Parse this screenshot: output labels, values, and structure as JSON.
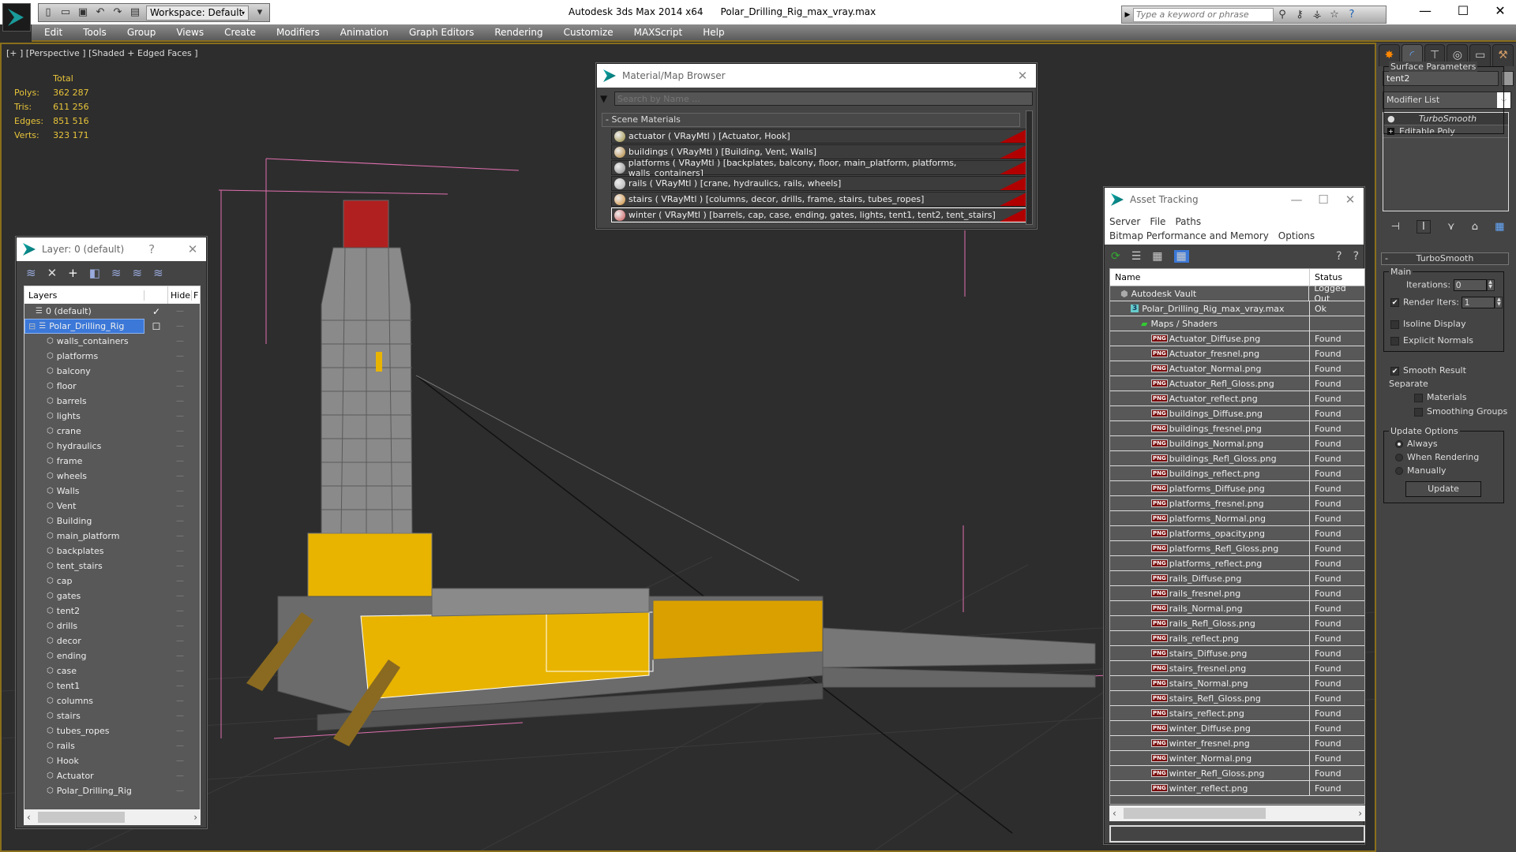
{
  "app": {
    "name": "Autodesk 3ds Max  2014 x64",
    "file": "Polar_Drilling_Rig_max_vray.max",
    "workspace": "Workspace: Default",
    "search_placeholder": "Type a keyword or phrase"
  },
  "menu": [
    "Edit",
    "Tools",
    "Group",
    "Views",
    "Create",
    "Modifiers",
    "Animation",
    "Graph Editors",
    "Rendering",
    "Customize",
    "MAXScript",
    "Help"
  ],
  "viewport": {
    "label": "[+ ] [Perspective ] [Shaded + Edged Faces ]",
    "stats_header": "Total",
    "stats": [
      {
        "label": "Polys:",
        "value": "362 287"
      },
      {
        "label": "Tris:",
        "value": "611 256"
      },
      {
        "label": "Edges:",
        "value": "851 516"
      },
      {
        "label": "Verts:",
        "value": "323 171"
      }
    ]
  },
  "layer_panel": {
    "title": "Layer: 0 (default)",
    "help": "?",
    "close": "✕",
    "col_layers": "Layers",
    "col_hide": "Hide",
    "col_freeze": "F",
    "rows": [
      {
        "name": "0 (default)",
        "level": 1,
        "type": "layer",
        "check": "✓"
      },
      {
        "name": "Polar_Drilling_Rig",
        "level": 0,
        "type": "layer",
        "selected": true,
        "check": "☐"
      },
      {
        "name": "walls_containers",
        "level": 2,
        "type": "object"
      },
      {
        "name": "platforms",
        "level": 2,
        "type": "object"
      },
      {
        "name": "balcony",
        "level": 2,
        "type": "object"
      },
      {
        "name": "floor",
        "level": 2,
        "type": "object"
      },
      {
        "name": "barrels",
        "level": 2,
        "type": "object"
      },
      {
        "name": "lights",
        "level": 2,
        "type": "object"
      },
      {
        "name": "crane",
        "level": 2,
        "type": "object"
      },
      {
        "name": "hydraulics",
        "level": 2,
        "type": "object"
      },
      {
        "name": "frame",
        "level": 2,
        "type": "object"
      },
      {
        "name": "wheels",
        "level": 2,
        "type": "object"
      },
      {
        "name": "Walls",
        "level": 2,
        "type": "object"
      },
      {
        "name": "Vent",
        "level": 2,
        "type": "object"
      },
      {
        "name": "Building",
        "level": 2,
        "type": "object"
      },
      {
        "name": "main_platform",
        "level": 2,
        "type": "object"
      },
      {
        "name": "backplates",
        "level": 2,
        "type": "object"
      },
      {
        "name": "tent_stairs",
        "level": 2,
        "type": "object"
      },
      {
        "name": "cap",
        "level": 2,
        "type": "object"
      },
      {
        "name": "gates",
        "level": 2,
        "type": "object"
      },
      {
        "name": "tent2",
        "level": 2,
        "type": "object"
      },
      {
        "name": "drills",
        "level": 2,
        "type": "object"
      },
      {
        "name": "decor",
        "level": 2,
        "type": "object"
      },
      {
        "name": "ending",
        "level": 2,
        "type": "object"
      },
      {
        "name": "case",
        "level": 2,
        "type": "object"
      },
      {
        "name": "tent1",
        "level": 2,
        "type": "object"
      },
      {
        "name": "columns",
        "level": 2,
        "type": "object"
      },
      {
        "name": "stairs",
        "level": 2,
        "type": "object"
      },
      {
        "name": "tubes_ropes",
        "level": 2,
        "type": "object"
      },
      {
        "name": "rails",
        "level": 2,
        "type": "object"
      },
      {
        "name": "Hook",
        "level": 2,
        "type": "object"
      },
      {
        "name": "Actuator",
        "level": 2,
        "type": "object"
      },
      {
        "name": "Polar_Drilling_Rig",
        "level": 2,
        "type": "object"
      }
    ]
  },
  "material_browser": {
    "title": "Material/Map Browser",
    "search_placeholder": "Search by Name ...",
    "section": "- Scene Materials",
    "materials": [
      {
        "label": "actuator  ( VRayMtl )  [Actuator, Hook]"
      },
      {
        "label": "buildings  ( VRayMtl )  [Building, Vent, Walls]"
      },
      {
        "label": "platforms  ( VRayMtl )  [backplates, balcony, floor, main_platform, platforms, walls_containers]"
      },
      {
        "label": "rails  ( VRayMtl )  [crane, hydraulics, rails, wheels]"
      },
      {
        "label": "stairs  ( VRayMtl )  [columns, decor, drills, frame, stairs, tubes_ropes]"
      },
      {
        "label": "winter  ( VRayMtl )  [barrels, cap, case, ending, gates, lights, tent1, tent2, tent_stairs]",
        "selected": true
      }
    ]
  },
  "asset_tracking": {
    "title": "Asset Tracking",
    "menu": [
      "Server",
      "File",
      "Paths",
      "Bitmap Performance and Memory",
      "Options"
    ],
    "col_name": "Name",
    "col_status": "Status",
    "rows": [
      {
        "name": "Autodesk Vault",
        "status": "Logged Out",
        "indent": 1,
        "icon": "vault"
      },
      {
        "name": "Polar_Drilling_Rig_max_vray.max",
        "status": "Ok",
        "indent": 2,
        "icon": "max"
      },
      {
        "name": "Maps / Shaders",
        "status": "",
        "indent": 3,
        "icon": "maps"
      },
      {
        "name": "Actuator_Diffuse.png",
        "status": "Found",
        "indent": 4,
        "icon": "png"
      },
      {
        "name": "Actuator_fresnel.png",
        "status": "Found",
        "indent": 4,
        "icon": "png"
      },
      {
        "name": "Actuator_Normal.png",
        "status": "Found",
        "indent": 4,
        "icon": "png"
      },
      {
        "name": "Actuator_Refl_Gloss.png",
        "status": "Found",
        "indent": 4,
        "icon": "png"
      },
      {
        "name": "Actuator_reflect.png",
        "status": "Found",
        "indent": 4,
        "icon": "png"
      },
      {
        "name": "buildings_Diffuse.png",
        "status": "Found",
        "indent": 4,
        "icon": "png"
      },
      {
        "name": "buildings_fresnel.png",
        "status": "Found",
        "indent": 4,
        "icon": "png"
      },
      {
        "name": "buildings_Normal.png",
        "status": "Found",
        "indent": 4,
        "icon": "png"
      },
      {
        "name": "buildings_Refl_Gloss.png",
        "status": "Found",
        "indent": 4,
        "icon": "png"
      },
      {
        "name": "buildings_reflect.png",
        "status": "Found",
        "indent": 4,
        "icon": "png"
      },
      {
        "name": "platforms_Diffuse.png",
        "status": "Found",
        "indent": 4,
        "icon": "png"
      },
      {
        "name": "platforms_fresnel.png",
        "status": "Found",
        "indent": 4,
        "icon": "png"
      },
      {
        "name": "platforms_Normal.png",
        "status": "Found",
        "indent": 4,
        "icon": "png"
      },
      {
        "name": "platforms_opacity.png",
        "status": "Found",
        "indent": 4,
        "icon": "png"
      },
      {
        "name": "platforms_Refl_Gloss.png",
        "status": "Found",
        "indent": 4,
        "icon": "png"
      },
      {
        "name": "platforms_reflect.png",
        "status": "Found",
        "indent": 4,
        "icon": "png"
      },
      {
        "name": "rails_Diffuse.png",
        "status": "Found",
        "indent": 4,
        "icon": "png"
      },
      {
        "name": "rails_fresnel.png",
        "status": "Found",
        "indent": 4,
        "icon": "png"
      },
      {
        "name": "rails_Normal.png",
        "status": "Found",
        "indent": 4,
        "icon": "png"
      },
      {
        "name": "rails_Refl_Gloss.png",
        "status": "Found",
        "indent": 4,
        "icon": "png"
      },
      {
        "name": "rails_reflect.png",
        "status": "Found",
        "indent": 4,
        "icon": "png"
      },
      {
        "name": "stairs_Diffuse.png",
        "status": "Found",
        "indent": 4,
        "icon": "png"
      },
      {
        "name": "stairs_fresnel.png",
        "status": "Found",
        "indent": 4,
        "icon": "png"
      },
      {
        "name": "stairs_Normal.png",
        "status": "Found",
        "indent": 4,
        "icon": "png"
      },
      {
        "name": "stairs_Refl_Gloss.png",
        "status": "Found",
        "indent": 4,
        "icon": "png"
      },
      {
        "name": "stairs_reflect.png",
        "status": "Found",
        "indent": 4,
        "icon": "png"
      },
      {
        "name": "winter_Diffuse.png",
        "status": "Found",
        "indent": 4,
        "icon": "png"
      },
      {
        "name": "winter_fresnel.png",
        "status": "Found",
        "indent": 4,
        "icon": "png"
      },
      {
        "name": "winter_Normal.png",
        "status": "Found",
        "indent": 4,
        "icon": "png"
      },
      {
        "name": "winter_Refl_Gloss.png",
        "status": "Found",
        "indent": 4,
        "icon": "png"
      },
      {
        "name": "winter_reflect.png",
        "status": "Found",
        "indent": 4,
        "icon": "png"
      }
    ]
  },
  "command_panel": {
    "object_name": "tent2",
    "modifier_list": "Modifier List",
    "stack": [
      "TurboSmooth",
      "Editable Poly"
    ],
    "rollout_title": "TurboSmooth",
    "main_group": "Main",
    "iterations_label": "Iterations:",
    "iterations_value": "0",
    "render_iters_label": "Render Iters:",
    "render_iters_value": "1",
    "render_iters_checked": true,
    "isoline_label": "Isoline Display",
    "isoline_checked": false,
    "explicit_normals_label": "Explicit Normals",
    "explicit_normals_checked": false,
    "surface_group": "Surface Parameters",
    "smooth_result_label": "Smooth Result",
    "smooth_result_checked": true,
    "separate_label": "Separate",
    "materials_label": "Materials",
    "smoothing_groups_label": "Smoothing Groups",
    "update_group": "Update Options",
    "update_options": [
      "Always",
      "When Rendering",
      "Manually"
    ],
    "update_selected": "Always",
    "update_button": "Update"
  },
  "colors": {
    "viewport_border": "#8a6f1c",
    "stats_text": "#e8c43a",
    "selection": "#3b78d8",
    "rig_yellow": "#e8b400",
    "rig_red": "#b02020",
    "helper_pink": "#e070b0"
  }
}
